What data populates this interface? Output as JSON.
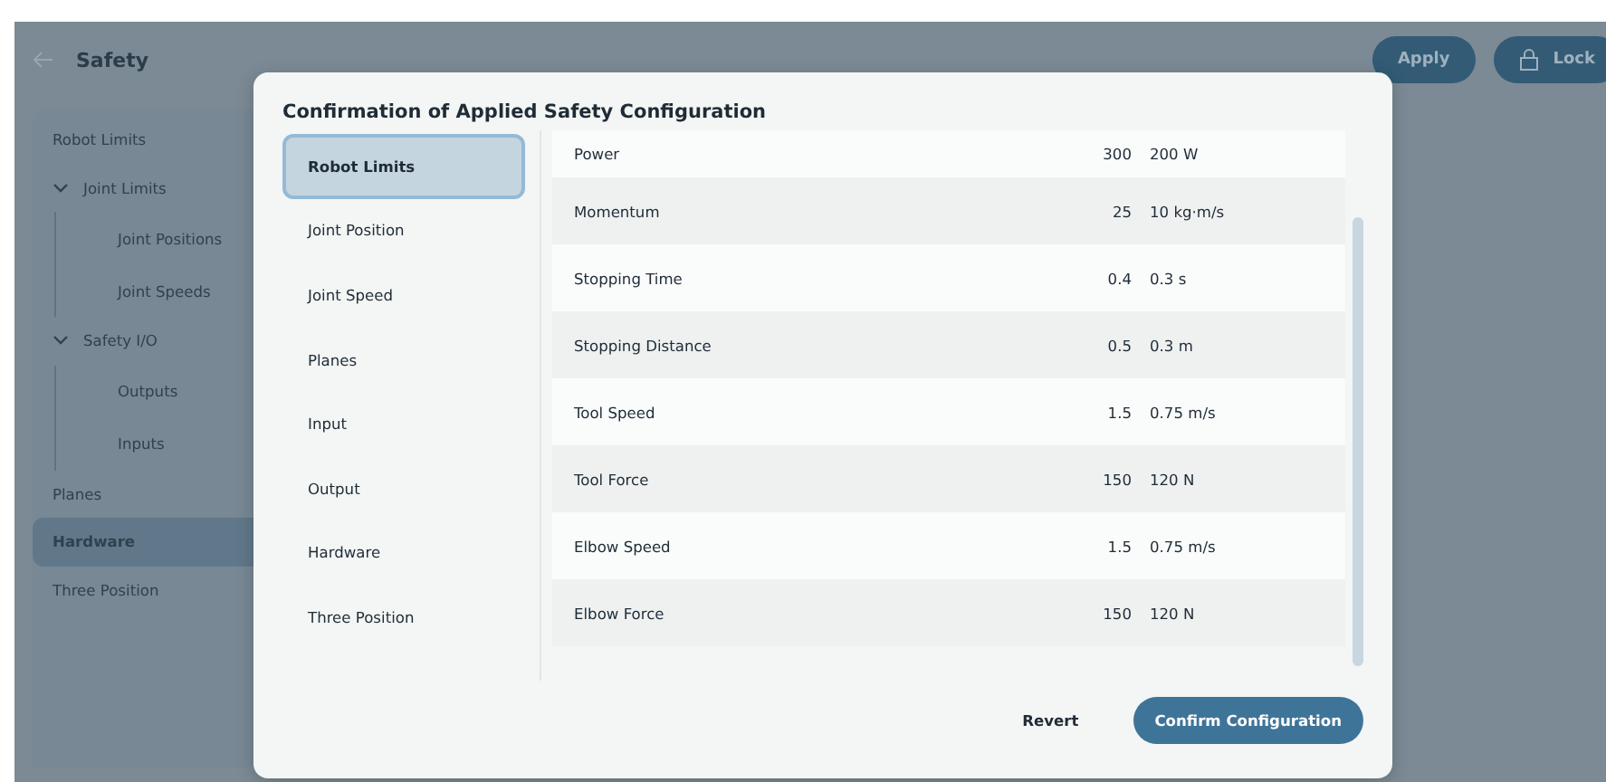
{
  "header": {
    "title": "Safety",
    "buttons": [
      {
        "label": "Apply",
        "kind": "plain"
      },
      {
        "label": "Lock",
        "kind": "lock"
      }
    ]
  },
  "sidebar": {
    "items": [
      {
        "label": "Robot Limits",
        "selected": false
      },
      {
        "label": "Joint Limits",
        "selected": false,
        "expanded": true,
        "children": [
          {
            "label": "Joint Positions",
            "selected": false
          },
          {
            "label": "Joint Speeds",
            "selected": false
          }
        ]
      },
      {
        "label": "Safety I/O",
        "selected": false,
        "expanded": true,
        "children": [
          {
            "label": "Outputs",
            "selected": false
          },
          {
            "label": "Inputs",
            "selected": false
          }
        ]
      },
      {
        "label": "Planes",
        "selected": false
      },
      {
        "label": "Hardware",
        "selected": true
      },
      {
        "label": "Three Position",
        "selected": false
      }
    ]
  },
  "dialog": {
    "title": "Confirmation of Applied Safety Configuration",
    "tabs": [
      {
        "label": "Robot Limits",
        "selected": true
      },
      {
        "label": "Joint Position",
        "selected": false
      },
      {
        "label": "Joint Speed",
        "selected": false
      },
      {
        "label": "Planes",
        "selected": false
      },
      {
        "label": "Input",
        "selected": false
      },
      {
        "label": "Output",
        "selected": false
      },
      {
        "label": "Hardware",
        "selected": false
      },
      {
        "label": "Three Position",
        "selected": false
      }
    ],
    "rows": [
      {
        "name": "Power",
        "value_1": "300",
        "value_2": "200 W"
      },
      {
        "name": "Momentum",
        "value_1": "25",
        "value_2": "10 kg·m/s"
      },
      {
        "name": "Stopping Time",
        "value_1": "0.4",
        "value_2": "0.3 s"
      },
      {
        "name": "Stopping Distance",
        "value_1": "0.5",
        "value_2": "0.3 m"
      },
      {
        "name": "Tool Speed",
        "value_1": "1.5",
        "value_2": "0.75 m/s"
      },
      {
        "name": "Tool Force",
        "value_1": "150",
        "value_2": "120 N"
      },
      {
        "name": "Elbow Speed",
        "value_1": "1.5",
        "value_2": "0.75 m/s"
      },
      {
        "name": "Elbow Force",
        "value_1": "150",
        "value_2": "120 N"
      }
    ],
    "buttons": [
      {
        "label": "Revert",
        "kind": "text"
      },
      {
        "label": "Confirm Configuration",
        "kind": "primary"
      }
    ]
  }
}
